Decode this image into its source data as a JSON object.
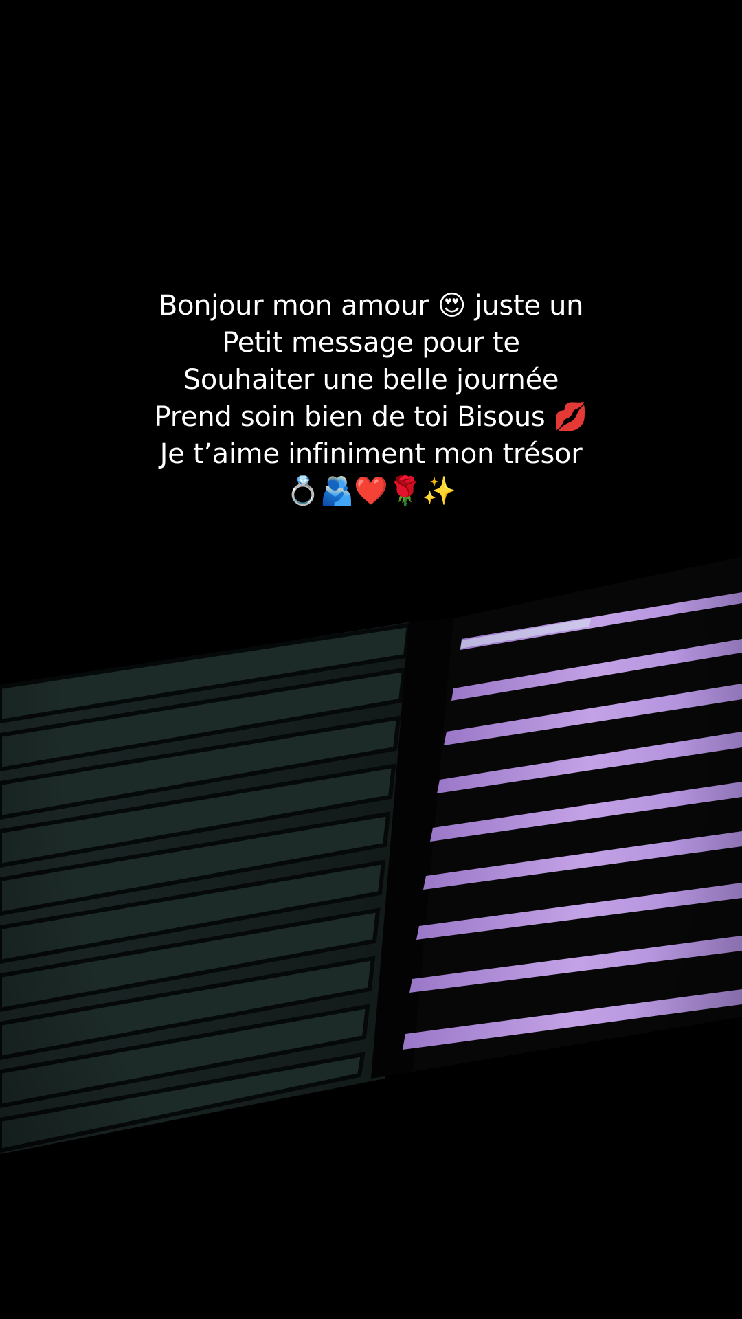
{
  "caption": {
    "lines": [
      "Bonjour mon amour 😍 juste un",
      "Petit message pour te",
      "Souhaiter une belle journée",
      "Prend soin bien de toi Bisous 💋",
      "Je t’aime infiniment mon trésor",
      "💍🫂❤️🌹✨"
    ]
  },
  "colors": {
    "background": "#000000",
    "left_shutter": "#16201f",
    "right_shutter_light": "#b48fd8",
    "text": "#ffffff"
  }
}
